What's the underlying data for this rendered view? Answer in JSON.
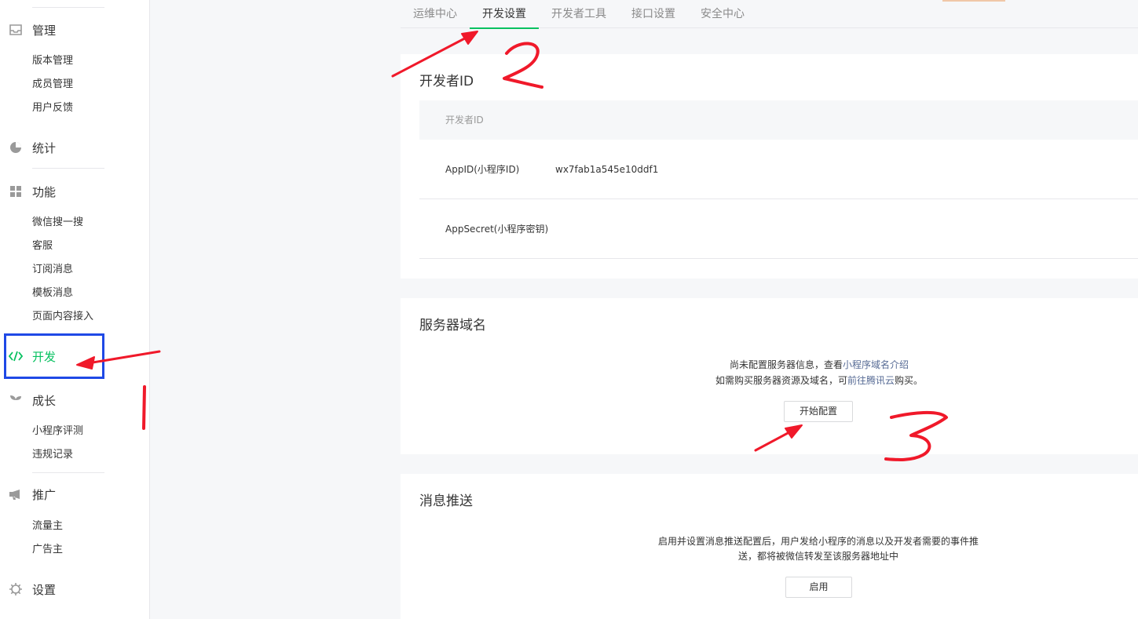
{
  "sidebar": {
    "groups": [
      {
        "label": "管理",
        "icon": "inbox-icon"
      },
      {
        "label": "统计",
        "icon": "pie-chart-icon"
      },
      {
        "label": "功能",
        "icon": "grid-icon"
      },
      {
        "label": "开发",
        "icon": "code-icon"
      },
      {
        "label": "成长",
        "icon": "sprout-icon"
      },
      {
        "label": "推广",
        "icon": "megaphone-icon"
      },
      {
        "label": "设置",
        "icon": "gear-icon"
      }
    ],
    "items": {
      "manage": [
        "版本管理",
        "成员管理",
        "用户反馈"
      ],
      "func": [
        "微信搜一搜",
        "客服",
        "订阅消息",
        "模板消息",
        "页面内容接入"
      ],
      "growth": [
        "小程序评测",
        "违规记录"
      ],
      "promo": [
        "流量主",
        "广告主"
      ]
    }
  },
  "tabs": [
    "运维中心",
    "开发设置",
    "开发者工具",
    "接口设置",
    "安全中心"
  ],
  "dev_id": {
    "title": "开发者ID",
    "header": "开发者ID",
    "rows": [
      {
        "key": "AppID(小程序ID)",
        "value": "wx7fab1a545e10ddf1"
      },
      {
        "key": "AppSecret(小程序密钥)",
        "value": ""
      }
    ]
  },
  "server": {
    "title": "服务器域名",
    "line1_prefix": "尚未配置服务器信息，查看",
    "line1_link": "小程序域名介绍",
    "line2_prefix": "如需购买服务器资源及域名，可",
    "line2_link": "前往腾讯云",
    "line2_suffix": "购买。",
    "button": "开始配置"
  },
  "push": {
    "title": "消息推送",
    "line1": "启用并设置消息推送配置后，用户发给小程序的消息以及开发者需要的事件推",
    "line2": "送，都将被微信转发至该服务器地址中",
    "button": "启用"
  },
  "annotations": {
    "num1": "1",
    "num2": "2",
    "num3": "3"
  },
  "colors": {
    "accent": "#07c160",
    "link": "#576b95",
    "annotation_red": "#f0192a",
    "highlight_blue": "#1f49e6"
  }
}
